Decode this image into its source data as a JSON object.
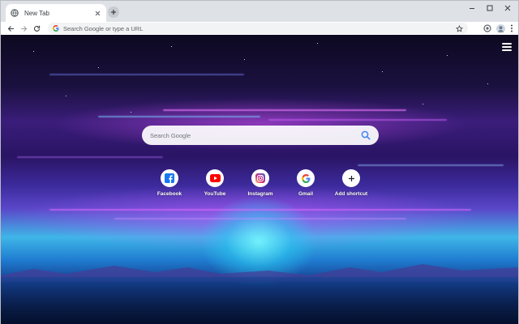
{
  "tab": {
    "title": "New Tab"
  },
  "toolbar": {
    "omnibox_placeholder": "Search Google or type a URL"
  },
  "search": {
    "placeholder": "Search Google"
  },
  "shortcuts": [
    {
      "label": "Facebook",
      "icon": "facebook-icon"
    },
    {
      "label": "YouTube",
      "icon": "youtube-icon"
    },
    {
      "label": "Instagram",
      "icon": "instagram-icon"
    },
    {
      "label": "Gmail",
      "icon": "google-icon"
    },
    {
      "label": "Add shortcut",
      "icon": "plus-icon"
    }
  ],
  "colors": {
    "facebook": "#1877f2",
    "youtube": "#ff0000",
    "instagram": "#c13584",
    "google_blue": "#4285f4",
    "search_icon": "#4285f4"
  }
}
